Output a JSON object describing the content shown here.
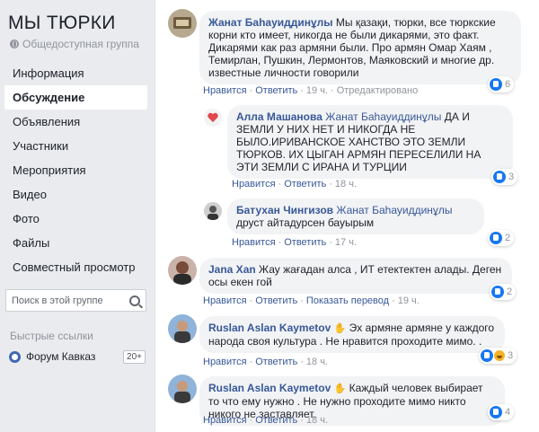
{
  "group": {
    "title": "МЫ ТЮРКИ",
    "privacy": "Общедоступная группа",
    "icon": "globe-icon"
  },
  "nav": [
    "Информация",
    "Обсуждение",
    "Объявления",
    "Участники",
    "Мероприятия",
    "Видео",
    "Фото",
    "Файлы",
    "Совместный просмотр"
  ],
  "nav_active": "Обсуждение",
  "search": {
    "placeholder": "Поиск в этой группе",
    "icon": "search-icon"
  },
  "quick_links": {
    "title": "Быстрые ссылки",
    "items": [
      {
        "label": "Форум Кавказ",
        "badge": "20+",
        "icon": "users-icon"
      }
    ]
  },
  "actions": {
    "like": "Нравится",
    "reply": "Ответить",
    "translate": "Показать перевод",
    "edited": "Отредактировано"
  },
  "comments": [
    {
      "author": "Жанат Баһауиддинұлы",
      "text": "Мы қазақи, тюрки, все тюркские корни кто имеет, никогда не были дикарями, это факт. Дикарями как раз армяни были. Про армян Омар Хаям , Темирлан, Пушкин, Лермонтов, Маяковский и многие др. известные личности говорили",
      "time": "19 ч.",
      "reactions": "6"
    },
    {
      "author": "Алла Машанова",
      "mention": "Жанат Баһауиддинұлы",
      "text": "ДА И ЗЕМЛИ У НИХ НЕТ И НИКОГДА НЕ БЫЛО.ИРИВАНСКОЕ ХАНСТВО ЭТО ЗЕМЛИ ТЮРКОВ. ИХ ЦЫГАН АРМЯН ПЕРЕСЕЛИЛИ НА ЭТИ ЗЕМЛИ С ИРАНА И ТУРЦИИ",
      "time": "18 ч.",
      "reactions": "3"
    },
    {
      "author": "Батухан Чингизов",
      "mention": "Жанат Баһауиддинұлы",
      "text": "друст айтадурсен бауырым",
      "time": "17 ч.",
      "reactions": "2"
    },
    {
      "author": "Jana Xan",
      "text": "Жау жағадан алса , ИТ етектектен алады. Деген осы екен гой",
      "time": "19 ч.",
      "reactions": "2"
    },
    {
      "author": "Ruslan Aslan Kaymetov",
      "text": "Эх армяне армяне у каждого народа своя культура . Не нравится проходите мимо. .",
      "time": "18 ч.",
      "reactions": "3"
    },
    {
      "author": "Ruslan Aslan Kaymetov",
      "text": "Каждый человек выбирает то что ему нужно . Не нужно проходите мимо никто никого не заставляет.",
      "time": "18 ч.",
      "reactions": "4"
    }
  ],
  "colors": {
    "link": "#385898",
    "like": "#1877f2",
    "bubble": "#f2f3f5"
  }
}
